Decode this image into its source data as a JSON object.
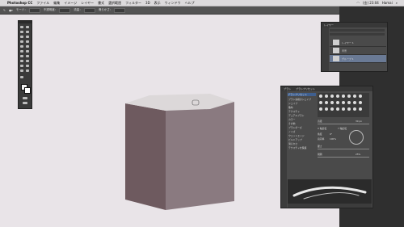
{
  "menubar": {
    "app_name": "Photoshop CC",
    "items": [
      "ファイル",
      "編集",
      "イメージ",
      "レイヤー",
      "書式",
      "選択範囲",
      "フィルター",
      "3D",
      "表示",
      "ウィンドウ",
      "ヘルプ"
    ],
    "clock": "(金) 23:04",
    "user": "Hamai"
  },
  "options_bar": {
    "items": [
      "モード：",
      "不透明度：",
      "流量：",
      "滑らかさ："
    ]
  },
  "layers_panel": {
    "tabs": [
      "レイヤー"
    ],
    "rows": [
      {
        "label": "レイヤー 1",
        "selected": false
      },
      {
        "label": "背景",
        "selected": false
      },
      {
        "label": "グループ 1",
        "selected": true
      }
    ]
  },
  "brush_panel": {
    "tabs": [
      "ブラシ",
      "ブラシプリセット"
    ],
    "preset_button": "ブラシプリセット",
    "settings": [
      "ブラシ先端のシェイプ",
      "シェイプ",
      "散布",
      "テクスチャ",
      "デュアルブラシ",
      "カラー",
      "その他",
      "ブラシポーズ",
      "ノイズ",
      "ウェットエッジ",
      "ビルドアップ",
      "滑らかさ",
      "テクスチャを保護"
    ],
    "size_label": "直径",
    "size_value": "30 px",
    "flip_x": "X 軸反転",
    "flip_y": "Y 軸反転",
    "angle_label": "角度",
    "angle_value": "0°",
    "roundness_label": "真円率",
    "roundness_value": "100%",
    "hardness_label": "硬さ",
    "spacing_label": "間隔",
    "spacing_value": "25%"
  },
  "colors": {
    "canvas": "#e9e4e8",
    "shape_front": "#6e5a5f",
    "shape_right": "#8a7a80",
    "shape_top": "#dcd8d9",
    "selected_layer": "#6a7a95"
  },
  "icons": [
    "apple-icon",
    "brush-tool-icon",
    "wifi-icon",
    "search-icon"
  ]
}
